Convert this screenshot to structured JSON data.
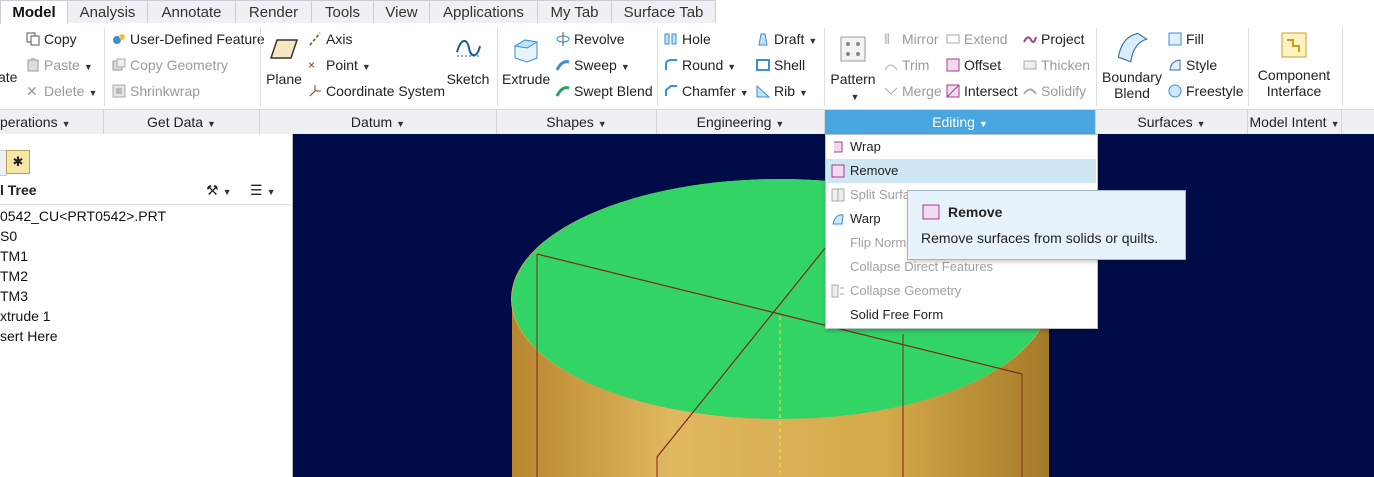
{
  "tabs": [
    "Model",
    "Analysis",
    "Annotate",
    "Render",
    "Tools",
    "View",
    "Applications",
    "My Tab",
    "Surface Tab"
  ],
  "ribbon": {
    "operations": {
      "copy": "Copy",
      "paste": "Paste",
      "delete": "Delete",
      "regen_partial": "ate"
    },
    "get_data": {
      "udf": "User-Defined Feature",
      "copy_geometry": "Copy Geometry",
      "shrinkwrap": "Shrinkwrap"
    },
    "datum": {
      "plane": "Plane",
      "axis": "Axis",
      "point": "Point",
      "csys": "Coordinate System",
      "sketch": "Sketch"
    },
    "shapes": {
      "extrude": "Extrude",
      "revolve": "Revolve",
      "sweep": "Sweep",
      "swept_blend": "Swept Blend"
    },
    "engineering": {
      "hole": "Hole",
      "round": "Round",
      "chamfer": "Chamfer",
      "draft": "Draft",
      "shell": "Shell",
      "rib": "Rib"
    },
    "editing": {
      "pattern": "Pattern",
      "mirror": "Mirror",
      "trim": "Trim",
      "merge": "Merge",
      "extend": "Extend",
      "offset": "Offset",
      "intersect": "Intersect",
      "project": "Project",
      "thicken": "Thicken",
      "solidify": "Solidify"
    },
    "surfaces": {
      "boundary_blend_1": "Boundary",
      "boundary_blend_2": "Blend",
      "fill": "Fill",
      "style": "Style",
      "freestyle": "Freestyle"
    },
    "model_intent": {
      "component_interface_1": "Component",
      "component_interface_2": "Interface"
    }
  },
  "groups": [
    "perations",
    "Get Data",
    "Datum",
    "Shapes",
    "Engineering",
    "Editing",
    "Surfaces",
    "Model Intent"
  ],
  "tree": {
    "title": "l Tree",
    "items": [
      "0542_CU<PRT0542>.PRT",
      "S0",
      "TM1",
      "TM2",
      "TM3",
      "xtrude 1",
      "sert Here"
    ]
  },
  "editing_menu": {
    "items": [
      "Wrap",
      "Remove",
      "Split Surfa",
      "Warp",
      "Flip Norm",
      "Collapse Direct Features",
      "Collapse Geometry",
      "Solid Free Form"
    ]
  },
  "tooltip": {
    "title": "Remove",
    "body": "Remove surfaces from solids or quilts."
  },
  "colors": {
    "accent": "#4aa6e0",
    "viewport_bg": "#000c48",
    "top_face": "#33d466",
    "cylinder": "#d4a94a"
  }
}
